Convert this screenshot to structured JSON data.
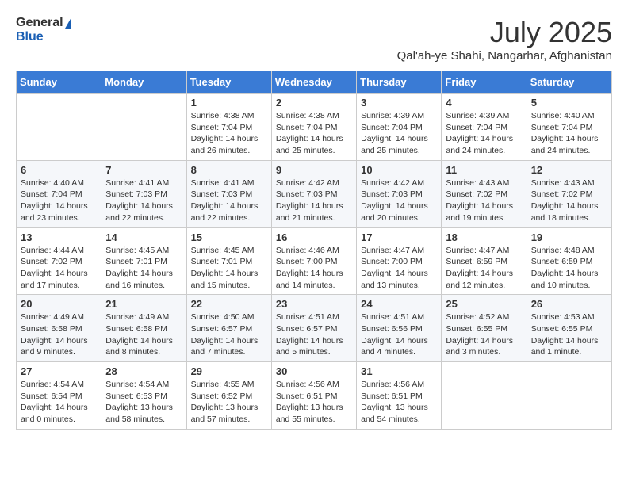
{
  "header": {
    "logo_general": "General",
    "logo_blue": "Blue",
    "month_title": "July 2025",
    "location": "Qal'ah-ye Shahi, Nangarhar, Afghanistan"
  },
  "days_of_week": [
    "Sunday",
    "Monday",
    "Tuesday",
    "Wednesday",
    "Thursday",
    "Friday",
    "Saturday"
  ],
  "weeks": [
    [
      {
        "day": "",
        "info": ""
      },
      {
        "day": "",
        "info": ""
      },
      {
        "day": "1",
        "info": "Sunrise: 4:38 AM\nSunset: 7:04 PM\nDaylight: 14 hours and 26 minutes."
      },
      {
        "day": "2",
        "info": "Sunrise: 4:38 AM\nSunset: 7:04 PM\nDaylight: 14 hours and 25 minutes."
      },
      {
        "day": "3",
        "info": "Sunrise: 4:39 AM\nSunset: 7:04 PM\nDaylight: 14 hours and 25 minutes."
      },
      {
        "day": "4",
        "info": "Sunrise: 4:39 AM\nSunset: 7:04 PM\nDaylight: 14 hours and 24 minutes."
      },
      {
        "day": "5",
        "info": "Sunrise: 4:40 AM\nSunset: 7:04 PM\nDaylight: 14 hours and 24 minutes."
      }
    ],
    [
      {
        "day": "6",
        "info": "Sunrise: 4:40 AM\nSunset: 7:04 PM\nDaylight: 14 hours and 23 minutes."
      },
      {
        "day": "7",
        "info": "Sunrise: 4:41 AM\nSunset: 7:03 PM\nDaylight: 14 hours and 22 minutes."
      },
      {
        "day": "8",
        "info": "Sunrise: 4:41 AM\nSunset: 7:03 PM\nDaylight: 14 hours and 22 minutes."
      },
      {
        "day": "9",
        "info": "Sunrise: 4:42 AM\nSunset: 7:03 PM\nDaylight: 14 hours and 21 minutes."
      },
      {
        "day": "10",
        "info": "Sunrise: 4:42 AM\nSunset: 7:03 PM\nDaylight: 14 hours and 20 minutes."
      },
      {
        "day": "11",
        "info": "Sunrise: 4:43 AM\nSunset: 7:02 PM\nDaylight: 14 hours and 19 minutes."
      },
      {
        "day": "12",
        "info": "Sunrise: 4:43 AM\nSunset: 7:02 PM\nDaylight: 14 hours and 18 minutes."
      }
    ],
    [
      {
        "day": "13",
        "info": "Sunrise: 4:44 AM\nSunset: 7:02 PM\nDaylight: 14 hours and 17 minutes."
      },
      {
        "day": "14",
        "info": "Sunrise: 4:45 AM\nSunset: 7:01 PM\nDaylight: 14 hours and 16 minutes."
      },
      {
        "day": "15",
        "info": "Sunrise: 4:45 AM\nSunset: 7:01 PM\nDaylight: 14 hours and 15 minutes."
      },
      {
        "day": "16",
        "info": "Sunrise: 4:46 AM\nSunset: 7:00 PM\nDaylight: 14 hours and 14 minutes."
      },
      {
        "day": "17",
        "info": "Sunrise: 4:47 AM\nSunset: 7:00 PM\nDaylight: 14 hours and 13 minutes."
      },
      {
        "day": "18",
        "info": "Sunrise: 4:47 AM\nSunset: 6:59 PM\nDaylight: 14 hours and 12 minutes."
      },
      {
        "day": "19",
        "info": "Sunrise: 4:48 AM\nSunset: 6:59 PM\nDaylight: 14 hours and 10 minutes."
      }
    ],
    [
      {
        "day": "20",
        "info": "Sunrise: 4:49 AM\nSunset: 6:58 PM\nDaylight: 14 hours and 9 minutes."
      },
      {
        "day": "21",
        "info": "Sunrise: 4:49 AM\nSunset: 6:58 PM\nDaylight: 14 hours and 8 minutes."
      },
      {
        "day": "22",
        "info": "Sunrise: 4:50 AM\nSunset: 6:57 PM\nDaylight: 14 hours and 7 minutes."
      },
      {
        "day": "23",
        "info": "Sunrise: 4:51 AM\nSunset: 6:57 PM\nDaylight: 14 hours and 5 minutes."
      },
      {
        "day": "24",
        "info": "Sunrise: 4:51 AM\nSunset: 6:56 PM\nDaylight: 14 hours and 4 minutes."
      },
      {
        "day": "25",
        "info": "Sunrise: 4:52 AM\nSunset: 6:55 PM\nDaylight: 14 hours and 3 minutes."
      },
      {
        "day": "26",
        "info": "Sunrise: 4:53 AM\nSunset: 6:55 PM\nDaylight: 14 hours and 1 minute."
      }
    ],
    [
      {
        "day": "27",
        "info": "Sunrise: 4:54 AM\nSunset: 6:54 PM\nDaylight: 14 hours and 0 minutes."
      },
      {
        "day": "28",
        "info": "Sunrise: 4:54 AM\nSunset: 6:53 PM\nDaylight: 13 hours and 58 minutes."
      },
      {
        "day": "29",
        "info": "Sunrise: 4:55 AM\nSunset: 6:52 PM\nDaylight: 13 hours and 57 minutes."
      },
      {
        "day": "30",
        "info": "Sunrise: 4:56 AM\nSunset: 6:51 PM\nDaylight: 13 hours and 55 minutes."
      },
      {
        "day": "31",
        "info": "Sunrise: 4:56 AM\nSunset: 6:51 PM\nDaylight: 13 hours and 54 minutes."
      },
      {
        "day": "",
        "info": ""
      },
      {
        "day": "",
        "info": ""
      }
    ]
  ]
}
